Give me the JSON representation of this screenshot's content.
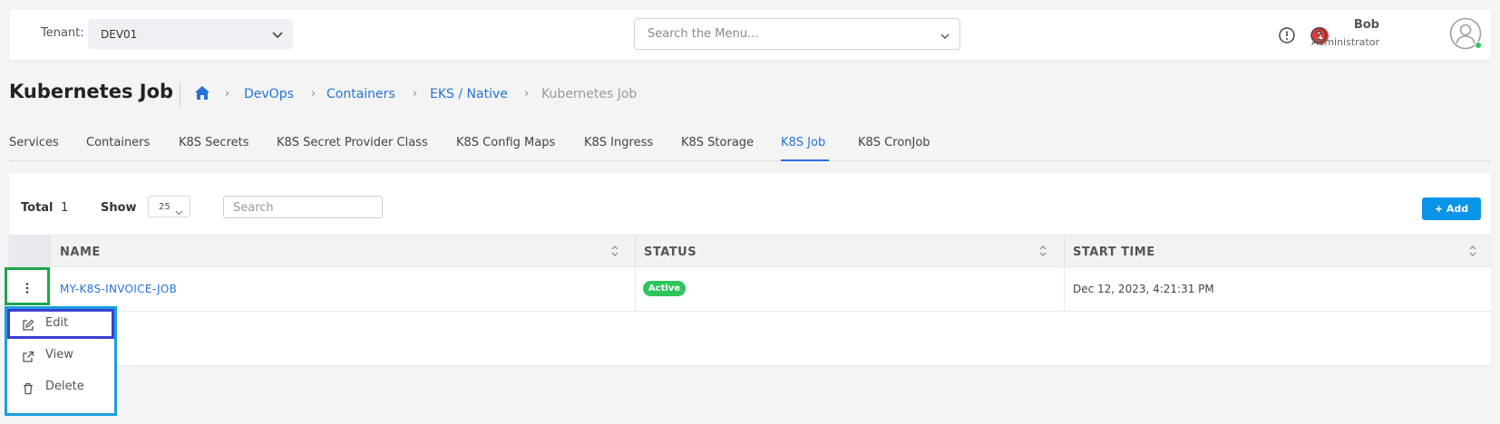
{
  "topbar": {
    "tenant_label": "Tenant:",
    "tenant_value": "DEV01",
    "search_placeholder": "Search the Menu...",
    "alert_count": "1",
    "user_name": "Bob",
    "user_role": "Administrator"
  },
  "page": {
    "title": "Kubernetes Job"
  },
  "breadcrumb": {
    "items": [
      "DevOps",
      "Containers",
      "EKS / Native",
      "Kubernetes Job"
    ],
    "separator": "›"
  },
  "tabs": [
    {
      "label": "Services"
    },
    {
      "label": "Containers"
    },
    {
      "label": "K8S Secrets"
    },
    {
      "label": "K8S Secret Provider Class"
    },
    {
      "label": "K8S Config Maps"
    },
    {
      "label": "K8S Ingress"
    },
    {
      "label": "K8S Storage"
    },
    {
      "label": "K8S Job"
    },
    {
      "label": "K8S CronJob"
    }
  ],
  "active_tab": "K8S Job",
  "table_toolbar": {
    "total_label": "Total",
    "total_value": "1",
    "show_label": "Show",
    "show_value": "25",
    "search_placeholder": "Search",
    "add_label": "+ Add"
  },
  "table": {
    "columns": [
      "NAME",
      "STATUS",
      "START TIME"
    ],
    "rows": [
      {
        "name": "MY-K8S-INVOICE-JOB",
        "status": "Active",
        "start_time": "Dec 12, 2023, 4:21:31 PM"
      }
    ]
  },
  "action_menu": {
    "items": [
      {
        "label": "Edit",
        "icon": "edit-icon"
      },
      {
        "label": "View",
        "icon": "external-link-icon"
      },
      {
        "label": "Delete",
        "icon": "trash-icon"
      }
    ]
  },
  "colors": {
    "accent": "#2673d9",
    "add_button": "#0a94e8",
    "status_active": "#2ec45c",
    "alert_badge": "#e53935",
    "highlight_green": "#1fa64d",
    "highlight_blue": "#1a9de0",
    "highlight_indigo": "#3b3fd0"
  }
}
